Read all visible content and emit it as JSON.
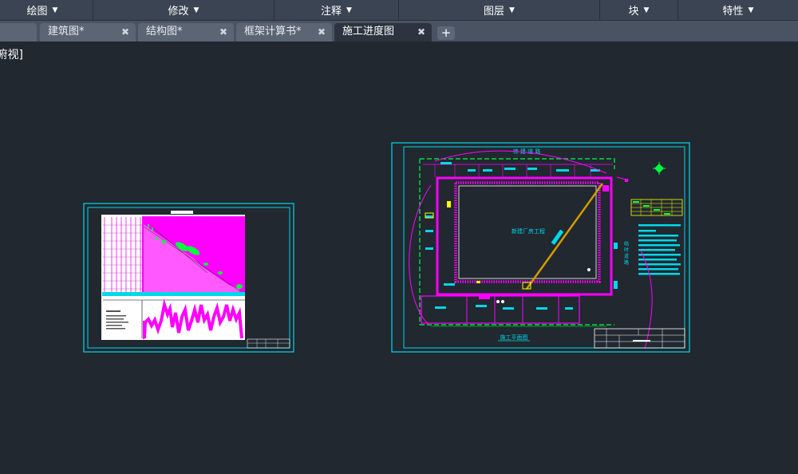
{
  "ribbon": {
    "panels": [
      {
        "label": "绘图"
      },
      {
        "label": "修改"
      },
      {
        "label": "注释"
      },
      {
        "label": "图层"
      },
      {
        "label": "块"
      },
      {
        "label": "特性"
      }
    ]
  },
  "tabs": [
    {
      "label": "建筑图*",
      "active": false
    },
    {
      "label": "结构图*",
      "active": false
    },
    {
      "label": "框架计算书*",
      "active": false
    },
    {
      "label": "施工进度图",
      "active": true
    }
  ],
  "viewport": {
    "label": "[俯视]",
    "sheet_right": {
      "top_road_label": "待 建 道 路",
      "building_label": "新建厂房工程",
      "side_label": "临 时 道 路",
      "caption": "施工平面图"
    }
  },
  "colors": {
    "background": "#212830",
    "frame": "#00d8e8",
    "magenta": "#ff00ff",
    "green": "#00ff3c",
    "yellow": "#ffff00",
    "white": "#ffffff"
  }
}
